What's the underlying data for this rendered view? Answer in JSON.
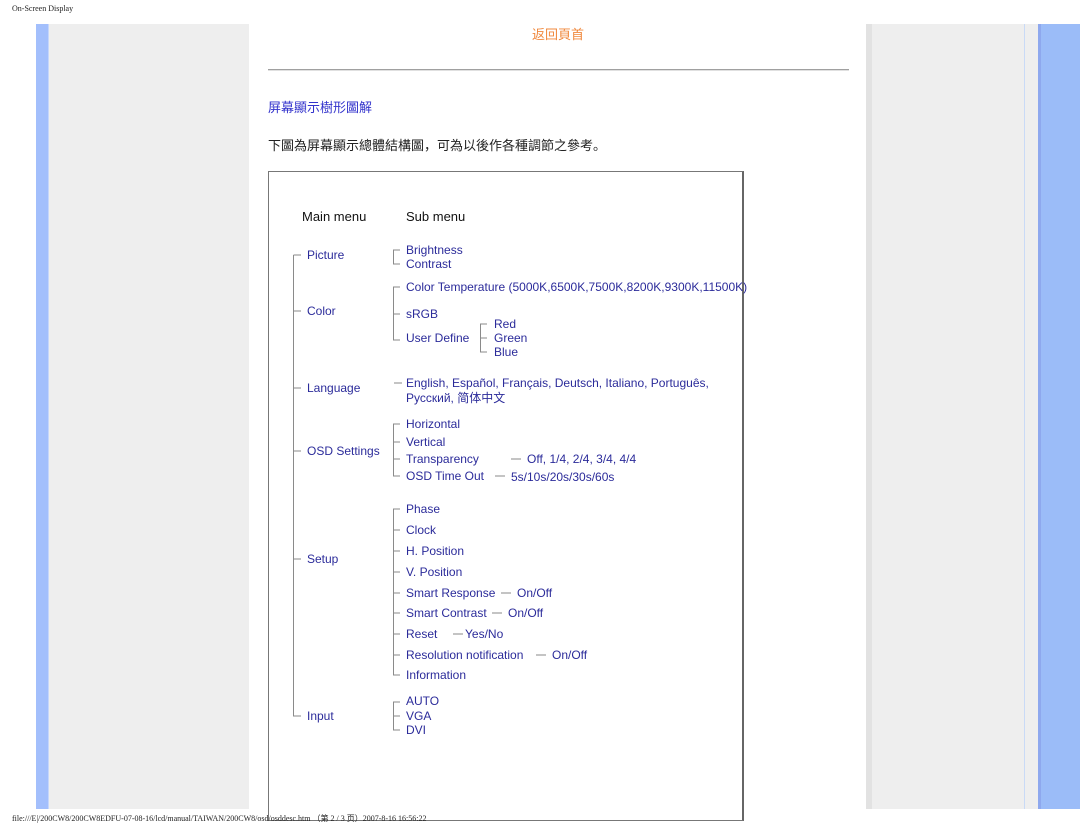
{
  "header": {
    "title": "On-Screen Display"
  },
  "nav": {
    "back_to_top": "返回頁首"
  },
  "section": {
    "title": "屏幕顯示樹形圖解",
    "intro": "下圖為屏幕顯示總體結構圖，可為以後作各種調節之參考。"
  },
  "tree": {
    "main_heading": "Main menu",
    "sub_heading": "Sub menu",
    "picture": {
      "label": "Picture",
      "items": [
        "Brightness",
        "Contrast"
      ]
    },
    "color": {
      "label": "Color",
      "color_temperature": "Color Temperature (5000K,6500K,7500K,8200K,9300K,11500K)",
      "srgb": "sRGB",
      "user_define": "User Define",
      "user_define_items": [
        "Red",
        "Green",
        "Blue"
      ]
    },
    "language": {
      "label": "Language",
      "line1": "English, Español, Français, Deutsch, Italiano, Português,",
      "line2": "Русский, 简体中文"
    },
    "osd": {
      "label": "OSD Settings",
      "horizontal": "Horizontal",
      "vertical": "Vertical",
      "transparency": "Transparency",
      "transparency_values": "Off, 1/4, 2/4, 3/4, 4/4",
      "timeout": "OSD Time Out",
      "timeout_values": "5s/10s/20s/30s/60s"
    },
    "setup": {
      "label": "Setup",
      "phase": "Phase",
      "clock": "Clock",
      "h_position": "H. Position",
      "v_position": "V. Position",
      "smart_response": "Smart Response",
      "smart_response_values": "On/Off",
      "smart_contrast": "Smart Contrast",
      "smart_contrast_values": "On/Off",
      "reset": "Reset",
      "reset_values": "Yes/No",
      "resolution_notification": "Resolution notification",
      "resolution_notification_values": "On/Off",
      "information": "Information"
    },
    "input": {
      "label": "Input",
      "items": [
        "AUTO",
        "VGA",
        "DVI"
      ]
    }
  },
  "footer": {
    "path": "file:///E|/200CW8/200CW8EDFU-07-08-16/lcd/manual/TAIWAN/200CW8/osd/osddesc.htm （第 2 / 3 页）2007-8-16 16:56:22"
  },
  "colors": {
    "link_orange": "#f0883c",
    "title_blue": "#3333cc",
    "tree_text": "#2b2b9a",
    "sidebar_blue": "#a3bffc"
  }
}
